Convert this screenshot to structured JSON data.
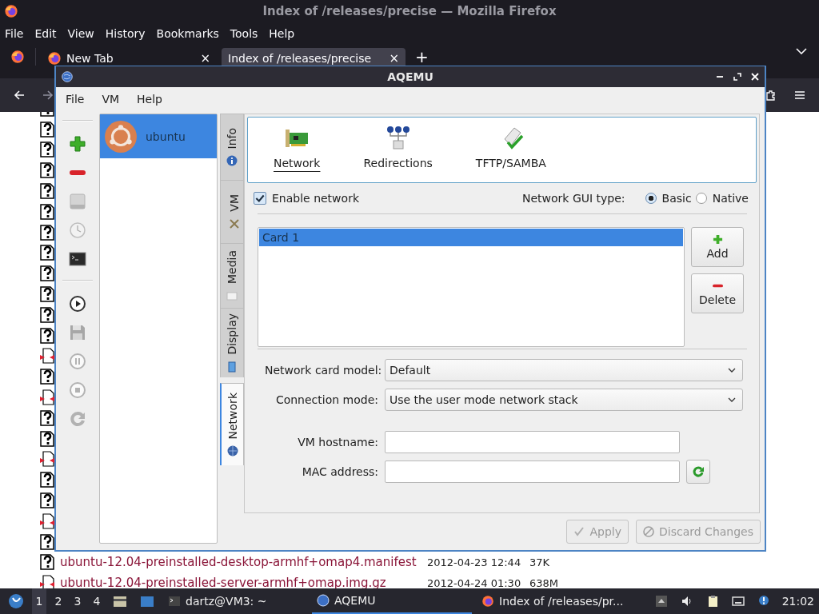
{
  "browser": {
    "title": "Index of /releases/precise — Mozilla Firefox",
    "menu": [
      "File",
      "Edit",
      "View",
      "History",
      "Bookmarks",
      "Tools",
      "Help"
    ],
    "tabs": [
      {
        "label": "New Tab",
        "close": "×",
        "selected": false
      },
      {
        "label": "Index of /releases/precise",
        "close": "×",
        "selected": true
      }
    ],
    "new_tab": "+",
    "listing": [
      {
        "kind": "unknown"
      },
      {
        "kind": "unknown"
      },
      {
        "kind": "unknown"
      },
      {
        "kind": "unknown"
      },
      {
        "kind": "unknown"
      },
      {
        "kind": "unknown"
      },
      {
        "kind": "unknown"
      },
      {
        "kind": "unknown"
      },
      {
        "kind": "unknown"
      },
      {
        "kind": "unknown"
      },
      {
        "kind": "unknown"
      },
      {
        "kind": "unknown"
      },
      {
        "kind": "binary"
      },
      {
        "kind": "unknown"
      },
      {
        "kind": "binary"
      },
      {
        "kind": "unknown"
      },
      {
        "kind": "unknown"
      },
      {
        "kind": "binary"
      },
      {
        "kind": "unknown"
      },
      {
        "kind": "unknown"
      },
      {
        "kind": "binary"
      },
      {
        "kind": "unknown"
      },
      {
        "kind": "unknown",
        "name": "ubuntu-12.04-preinstalled-desktop-armhf+omap4.manifest",
        "date": "2012-04-23 12:44",
        "size": "37K"
      },
      {
        "kind": "binary",
        "name": "ubuntu-12.04-preinstalled-server-armhf+omap.img.gz",
        "date": "2012-04-24 01:30",
        "size": "638M"
      }
    ]
  },
  "aqemu": {
    "title": "AQEMU",
    "menu": [
      "File",
      "VM",
      "Help"
    ],
    "toolbar": [
      {
        "kind": "separator"
      },
      {
        "kind": "add",
        "disabled": false
      },
      {
        "kind": "remove",
        "disabled": false
      },
      {
        "kind": "disk",
        "disabled": true
      },
      {
        "kind": "clock",
        "disabled": true
      },
      {
        "kind": "terminal",
        "disabled": false
      },
      {
        "kind": "separator"
      },
      {
        "kind": "play",
        "disabled": false
      },
      {
        "kind": "save",
        "disabled": true
      },
      {
        "kind": "pause",
        "disabled": true
      },
      {
        "kind": "stop",
        "disabled": true
      },
      {
        "kind": "reload",
        "disabled": true
      }
    ],
    "vms": [
      {
        "name": "ubuntu",
        "selected": true
      }
    ],
    "side_tabs": [
      {
        "label": "Info",
        "kind": "info",
        "selected": false
      },
      {
        "label": "VM",
        "kind": "vm",
        "selected": false
      },
      {
        "label": "Media",
        "kind": "media",
        "selected": false
      },
      {
        "label": "Display",
        "kind": "display",
        "selected": false
      },
      {
        "label": "Network",
        "kind": "network",
        "selected": true
      }
    ],
    "sections": [
      {
        "label": "Network",
        "kind": "network",
        "selected": true
      },
      {
        "label": "Redirections",
        "kind": "redirections",
        "selected": false
      },
      {
        "label": "TFTP/SAMBA",
        "kind": "tftp",
        "selected": false
      }
    ],
    "enable_network": {
      "label": "Enable network",
      "checked": true
    },
    "gui_type": {
      "label": "Network GUI type:",
      "options": [
        {
          "label": "Basic",
          "selected": true
        },
        {
          "label": "Native",
          "selected": false
        }
      ]
    },
    "cards": [
      {
        "label": "Card 1",
        "selected": true
      }
    ],
    "card_buttons": [
      {
        "kind": "add",
        "label": "Add"
      },
      {
        "kind": "delete",
        "label": "Delete"
      }
    ],
    "fields": [
      {
        "kind": "select",
        "label": "Network card model:",
        "value": "Default"
      },
      {
        "kind": "select",
        "label": "Connection mode:",
        "value": "Use the user mode network stack"
      },
      {
        "kind": "input",
        "label": "VM hostname:"
      },
      {
        "kind": "input_refresh",
        "label": "MAC address:"
      }
    ],
    "buttons": [
      {
        "kind": "apply",
        "label": "Apply",
        "disabled": true
      },
      {
        "kind": "discard",
        "label": "Discard Changes",
        "disabled": true
      }
    ]
  },
  "taskbar": {
    "workspaces": [
      {
        "label": "1",
        "selected": true
      },
      {
        "label": "2",
        "selected": false
      },
      {
        "label": "3",
        "selected": false
      },
      {
        "label": "4",
        "selected": false
      }
    ],
    "tasks": [
      {
        "kind": "terminal",
        "label": "dartz@VM3: ~",
        "selected": false
      },
      {
        "kind": "aqemu",
        "label": "AQEMU",
        "selected": true
      },
      {
        "kind": "firefox",
        "label": "Index of /releases/pr...",
        "selected": false
      }
    ],
    "clock": "21:02"
  }
}
